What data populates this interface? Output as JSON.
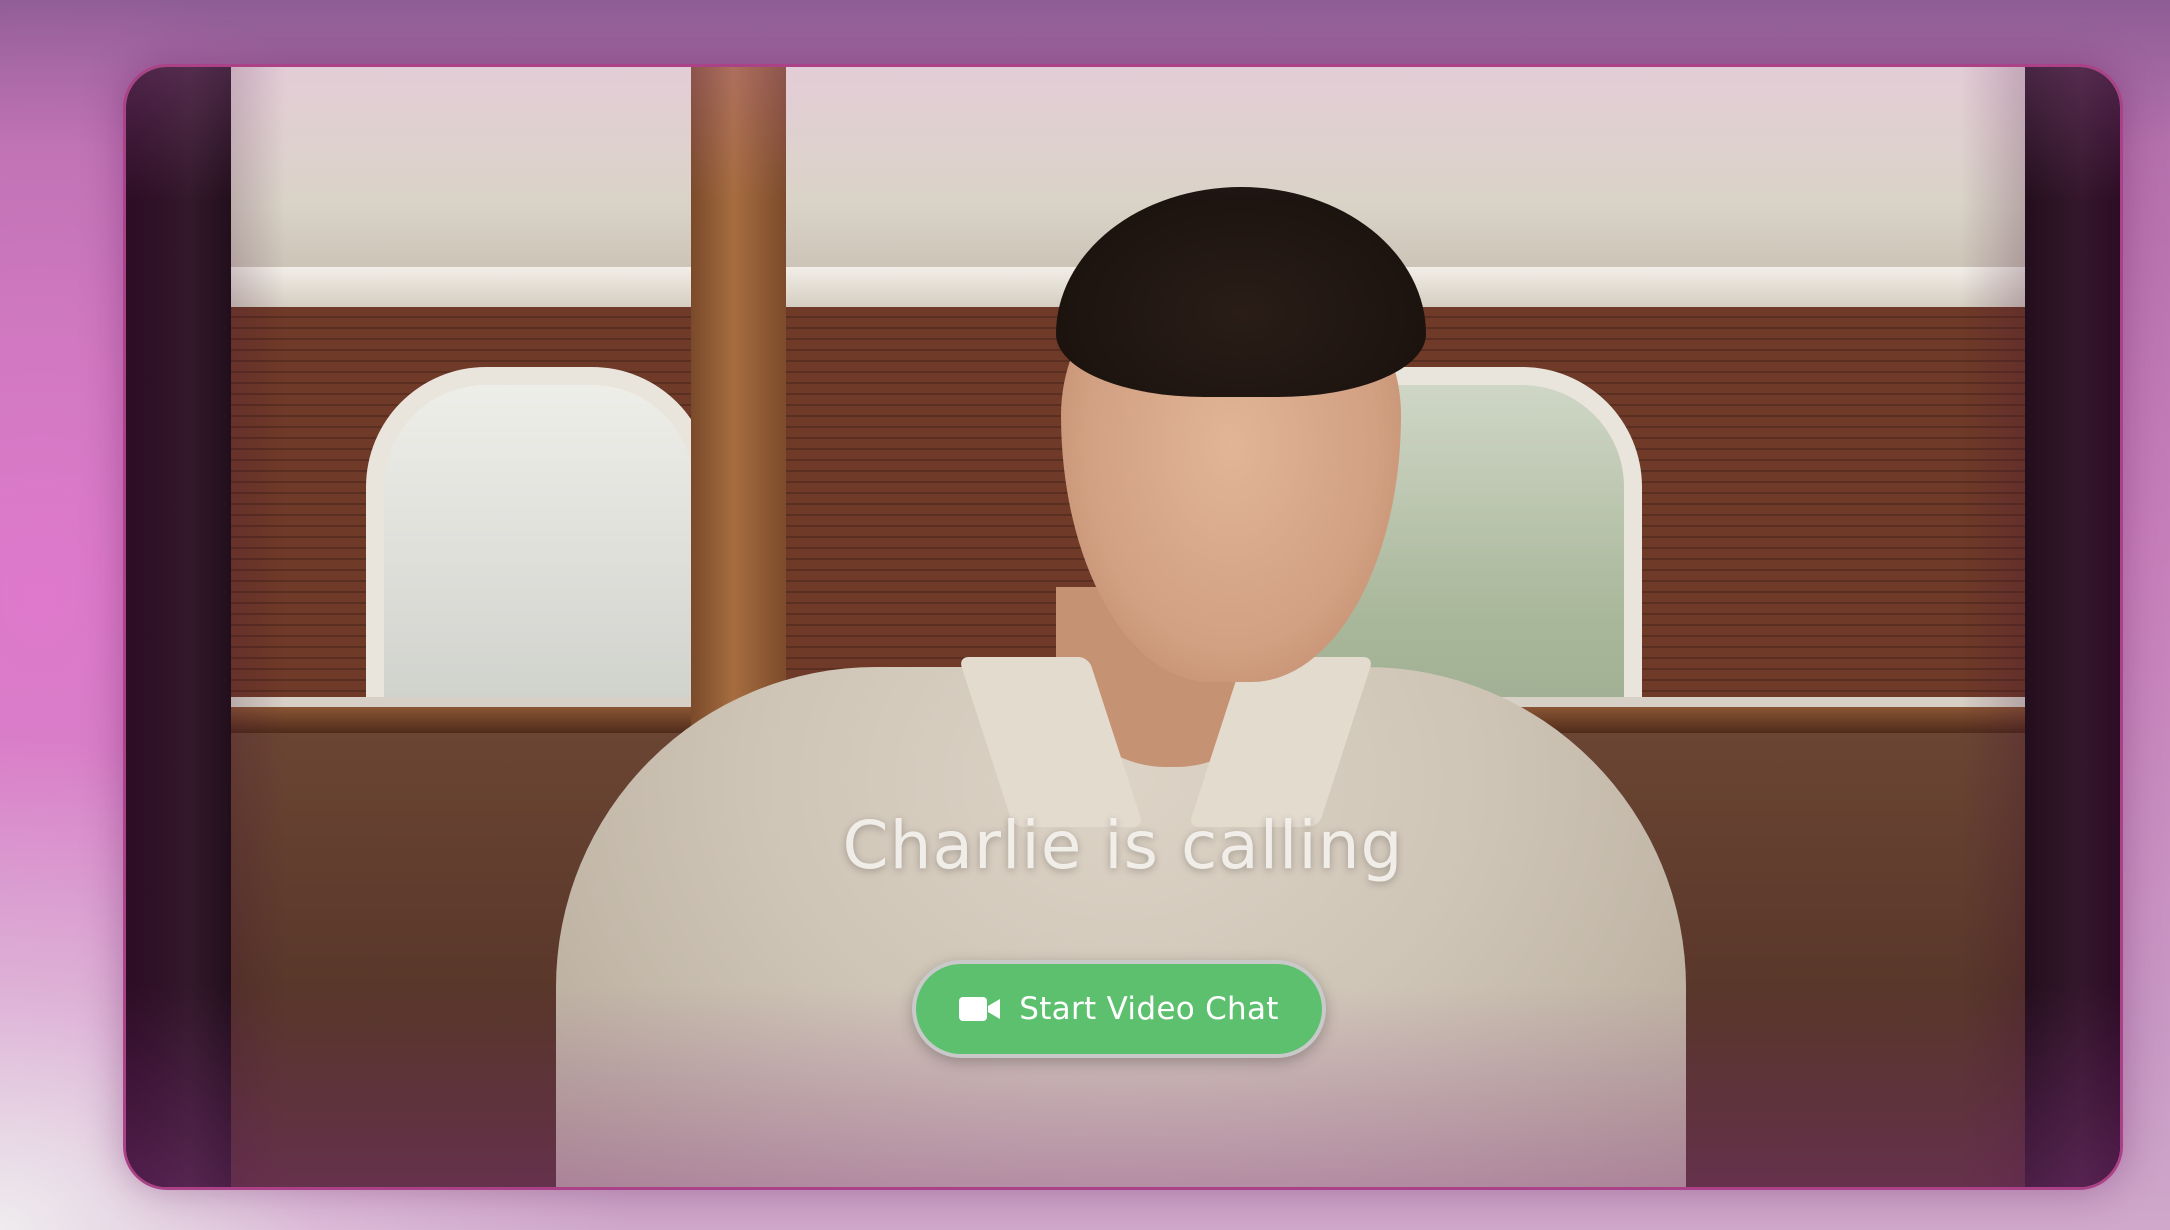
{
  "call": {
    "caller_text": "Charlie is calling",
    "start_button_label": "Start Video Chat",
    "start_button_icon": "video-camera-icon"
  },
  "colors": {
    "button_green": "#5dc06f",
    "card_border_pink": "#d750aa",
    "background_pink": "#c77fba"
  }
}
